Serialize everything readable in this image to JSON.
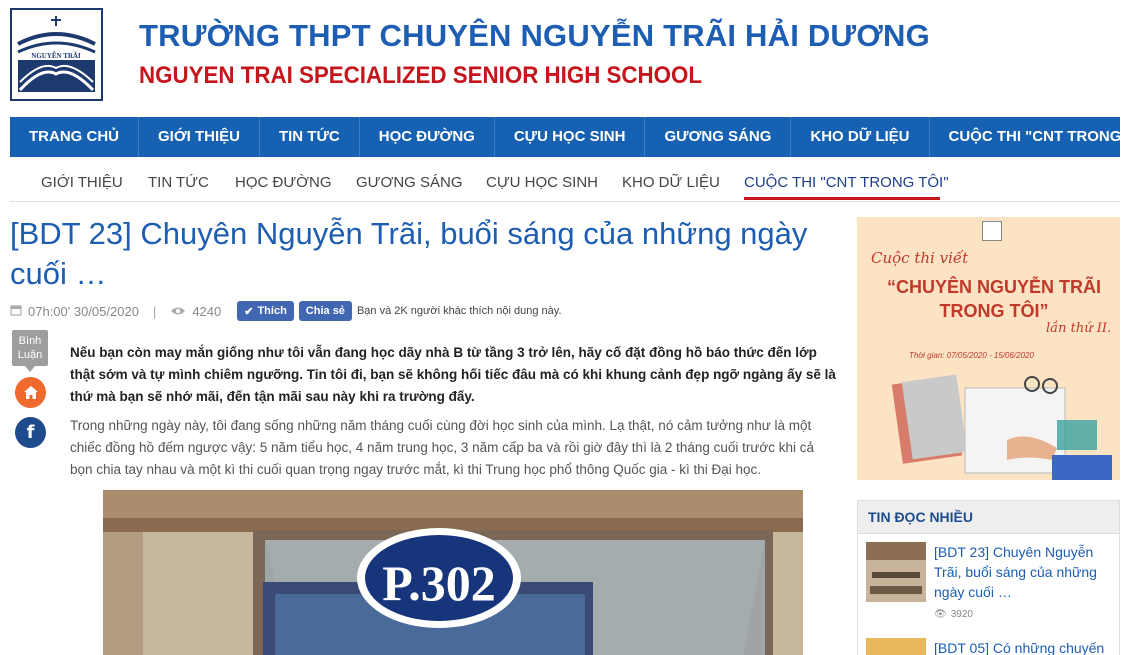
{
  "header": {
    "logo_text": "NGUYỄN TRÃI",
    "school_name_vn": "TRƯỜNG THPT CHUYÊN NGUYỄN TRÃI HẢI DƯƠNG",
    "school_name_en": "NGUYEN TRAI SPECIALIZED SENIOR HIGH SCHOOL"
  },
  "main_nav": [
    "TRANG CHỦ",
    "GIỚI THIỆU",
    "TIN TỨC",
    "HỌC ĐƯỜNG",
    "CỰU HỌC SINH",
    "GƯƠNG SÁNG",
    "KHO DỮ LIỆU",
    "CUỘC THI \"CNT TRONG TÔI\""
  ],
  "sub_nav": [
    "GIỚI THIỆU",
    "TIN TỨC",
    "HỌC ĐƯỜNG",
    "GƯƠNG SÁNG",
    "CỰU HỌC SINH",
    "KHO DỮ LIỆU",
    "CUỘC THI \"CNT TRONG TÔI\""
  ],
  "sub_nav_active": 6,
  "article": {
    "title": "[BDT 23] Chuyên Nguyễn Trãi, buổi sáng của những ngày cuối …",
    "datetime": "07h:00' 30/05/2020",
    "separator": "|",
    "views": "4240",
    "like_label": "Thích",
    "share_label": "Chia sẻ",
    "like_text": "Bạn và 2K người khác thích nội dung này.",
    "lead": "Nếu bạn còn may mắn giống như tôi vẫn đang học dãy nhà B từ tầng 3 trở lên, hãy cố đặt đồng hồ báo thức đến lớp thật sớm và tự mình chiêm ngưỡng. Tin tôi đi, bạn sẽ không hối tiếc đâu mà có khi khung cảnh đẹp ngỡ ngàng ấy sẽ là thứ mà bạn sẽ nhớ mãi, đến tận mãi sau này khi ra trường đấy.",
    "body": "Trong những ngày này, tôi đang sống những năm tháng cuối cùng đời học sinh của mình. Lạ thật, nó cảm tưởng như là một chiếc đồng hồ đếm ngược vậy: 5 năm tiểu học, 4 năm trung học, 3 năm cấp ba và rồi giờ đây thì là 2 tháng cuối trước khi cả bọn chia tay nhau và một kì thi cuối quan trọng ngay trước mắt, kì thi Trung học phổ thông Quốc gia - kì thi Đại học.",
    "photo_sign": "P.302"
  },
  "share": {
    "comment_label": "Bình Luận",
    "facebook_glyph": "f"
  },
  "banner": {
    "line1": "Cuộc thi viết",
    "line2": "“CHUYÊN NGUYỄN TRÃI TRONG TÔI”",
    "line3": "lần thứ II.",
    "time": "Thời gian: 07/05/2020 - 15/06/2020"
  },
  "most_read": {
    "heading": "TIN ĐỌC NHIỀU",
    "items": [
      {
        "title": "[BDT 23] Chuyên Nguyễn Trãi, buổi sáng của những ngày cuối …",
        "views": "3920"
      },
      {
        "title": "[BDT 05] Có những chuyến",
        "views": ""
      }
    ]
  },
  "colors": {
    "brand_blue": "#1661b2",
    "title_blue": "#1d5db2",
    "accent_red": "#c4161c"
  }
}
